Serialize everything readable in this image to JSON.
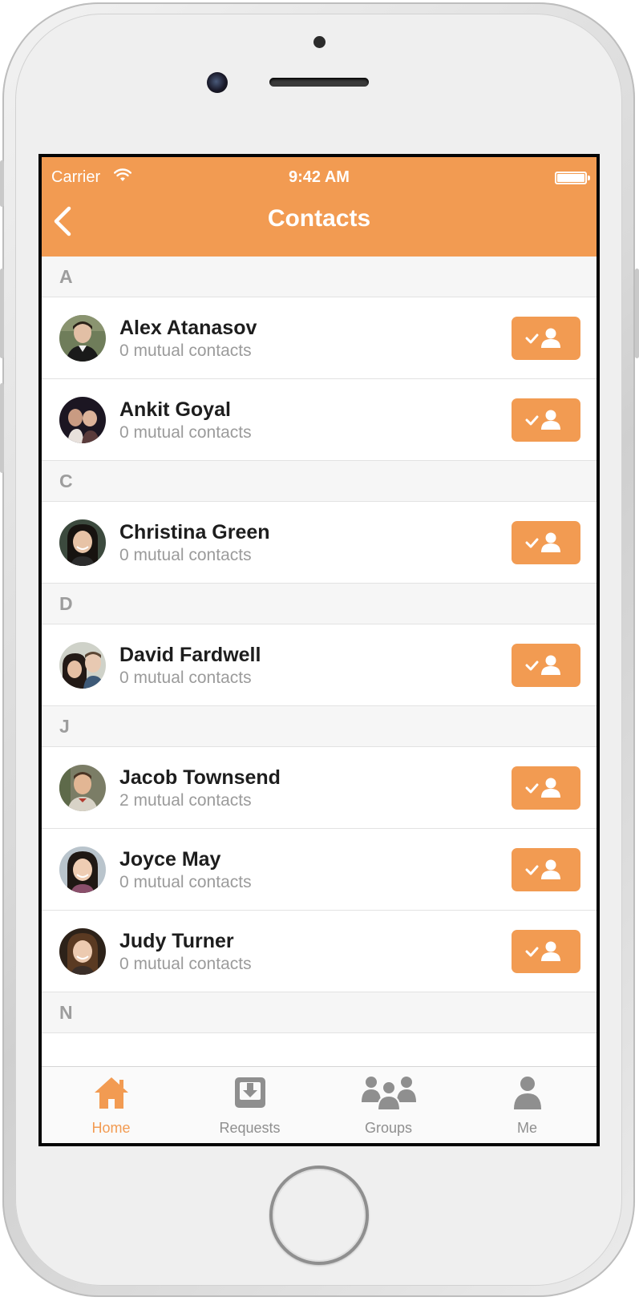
{
  "status_bar": {
    "carrier": "Carrier",
    "time": "9:42 AM"
  },
  "nav": {
    "title": "Contacts"
  },
  "sections": [
    {
      "letter": "A"
    },
    {
      "letter": "C"
    },
    {
      "letter": "D"
    },
    {
      "letter": "J"
    },
    {
      "letter": "N"
    }
  ],
  "contacts": [
    {
      "name": "Alex Atanasov",
      "mutual": "0 mutual contacts"
    },
    {
      "name": "Ankit Goyal",
      "mutual": "0 mutual contacts"
    },
    {
      "name": "Christina Green",
      "mutual": "0 mutual contacts"
    },
    {
      "name": "David Fardwell",
      "mutual": "0 mutual contacts"
    },
    {
      "name": "Jacob Townsend",
      "mutual": "2 mutual contacts"
    },
    {
      "name": "Joyce May",
      "mutual": "0 mutual contacts"
    },
    {
      "name": "Judy Turner",
      "mutual": "0 mutual contacts"
    }
  ],
  "tabs": [
    {
      "label": "Home",
      "icon": "home-icon",
      "active": true
    },
    {
      "label": "Requests",
      "icon": "requests-icon",
      "active": false
    },
    {
      "label": "Groups",
      "icon": "groups-icon",
      "active": false
    },
    {
      "label": "Me",
      "icon": "me-icon",
      "active": false
    }
  ],
  "colors": {
    "accent": "#f29b52",
    "tab_inactive": "#8f8f8f"
  }
}
